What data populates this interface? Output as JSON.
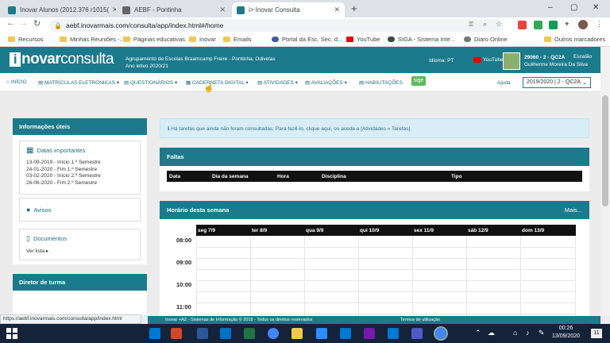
{
  "browser": {
    "tabs": [
      {
        "title": "Inovar Alunos (2012.376 r1015(",
        "active": false,
        "favicon_color": "#1b7a8c"
      },
      {
        "title": "AEBF - Pontinha",
        "active": false,
        "favicon_color": "#555555"
      },
      {
        "title": "i> Inovar Consulta",
        "active": true,
        "favicon_color": "#1b7a8c"
      }
    ],
    "new_tab_symbol": "+",
    "window_controls": [
      "–",
      "▢",
      "✕"
    ],
    "url": "aebf.inovarmais.com/consulta/app/index.html#/home",
    "bookmarks": [
      "Recursos",
      "Minhas Reuniões -...",
      "Páginas educativas",
      "Inovar",
      "Emails",
      "Portal da Esc. Sec. d...",
      "YouTube",
      "SIGA - Sistema Inte...",
      "Diaro Online",
      "Outros marcadores"
    ]
  },
  "app": {
    "logo_i": "i",
    "logo_text": "novar",
    "logo_text2": "consulta",
    "school_line1": "Agrupamento de Escolas Braamcamp Freire - Pontinha, Odivelas",
    "school_line2": "Ano letivo 2020/21",
    "language_label": "Idioma: PT",
    "youtube_label": "YouTube",
    "user_code": "29060 - 2 - QC2A",
    "user_name": "Guilherme Moreira Da Silva",
    "user_role": "Escalão",
    "brand_color": "#1b7a8c"
  },
  "nav": {
    "items": [
      "INÍCIO",
      "MATRÍCULAS ELETRÓNICAS",
      "QUESTIONÁRIOS",
      "CADERNETA DIGITAL",
      "ATIVIDADES",
      "AVALIAÇÕES",
      "HABILITAÇÕES"
    ],
    "sige": "sige",
    "help": "Ajuda",
    "year_select": "2019/2020 | 2 - QC2A"
  },
  "sidebar": {
    "info_title": "Informações úteis",
    "dates_title": "Datas importantes",
    "dates": [
      "13-09-2019 - Início 1.º Semestre",
      "24-01-2020 - Fim 1.º Semestre",
      "03-02-2020 - Início 2.º Semestre",
      "26-06-2020 - Fim 2.º Semestre"
    ],
    "avisos_title": "Avisos",
    "docs_title": "Documentos",
    "docs_link": "Ver lista",
    "director_title": "Diretor de turma"
  },
  "main": {
    "alert_text": "Há tarefas que ainda não foram consultadas. Para fazê-lo, clique aqui, ou aceda a [Atividades » Tarefas].",
    "faltas_title": "Faltas",
    "faltas_columns": [
      "Data",
      "Dia da semana",
      "Hora",
      "Disciplina",
      "Tipo"
    ],
    "horario_title": "Horário desta semana",
    "horario_more": "Mais...",
    "days": [
      "seg 7/9",
      "ter 8/9",
      "qua 9/9",
      "qui 10/9",
      "sex 11/9",
      "sáb 12/9",
      "dom 13/9"
    ],
    "times": [
      "08:00",
      "09:00",
      "10:00",
      "11:00"
    ]
  },
  "footer": {
    "left": "Inovar +AZ - Sistemas de Informação © 2019 - Todos os direitos reservados",
    "right": "Termos de utilização"
  },
  "status_url": "https://aebf.inovarmais.com/consulta/app/index.html",
  "taskbar": {
    "time": "00:26",
    "date": "13/09/2020",
    "notification_count": "11"
  }
}
